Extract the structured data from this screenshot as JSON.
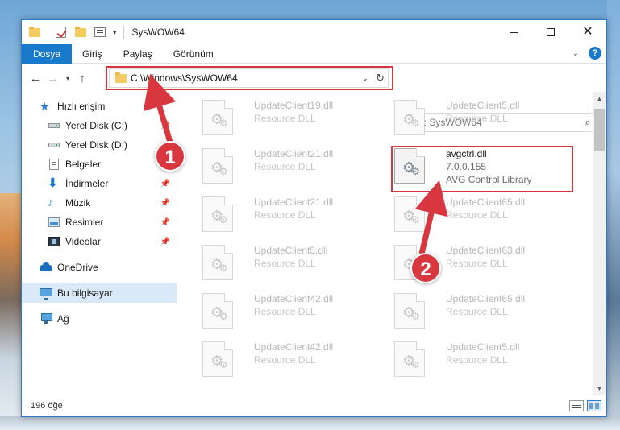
{
  "window": {
    "title": "SysWOW64"
  },
  "ribbon": {
    "tabs": [
      "Dosya",
      "Giriş",
      "Paylaş",
      "Görünüm"
    ],
    "help": "?"
  },
  "nav": {
    "address": "C:\\Windows\\SysWOW64",
    "search_placeholder": "Ara: SysWOW64"
  },
  "sidebar": {
    "items": [
      {
        "label": "Hızlı erişim",
        "icon": "star-icon"
      },
      {
        "label": "Yerel Disk (C:)",
        "icon": "disk-icon"
      },
      {
        "label": "Yerel Disk (D:)",
        "icon": "disk-icon"
      },
      {
        "label": "Belgeler",
        "icon": "document-icon"
      },
      {
        "label": "İndirmeler",
        "icon": "download-icon"
      },
      {
        "label": "Müzik",
        "icon": "music-icon"
      },
      {
        "label": "Resimler",
        "icon": "pictures-icon"
      },
      {
        "label": "Videolar",
        "icon": "video-icon"
      },
      {
        "label": "OneDrive",
        "icon": "onedrive-icon"
      },
      {
        "label": "Bu bilgisayar",
        "icon": "computer-icon"
      },
      {
        "label": "Ağ",
        "icon": "network-icon"
      }
    ]
  },
  "files": {
    "left": [
      {
        "name": "UpdateClient19.dll",
        "desc": "Resource DLL"
      },
      {
        "name": "UpdateClient21.dll",
        "desc": "Resource DLL"
      },
      {
        "name": "UpdateClient21.dll",
        "desc": "Resource DLL"
      },
      {
        "name": "UpdateClient5.dll",
        "desc": "Resource DLL"
      },
      {
        "name": "UpdateClient42.dll",
        "desc": "Resource DLL"
      },
      {
        "name": "UpdateClient42.dll",
        "desc": "Resource DLL"
      }
    ],
    "right": [
      {
        "name": "UpdateClient5.dll",
        "desc": "Resource DLL"
      },
      {
        "name": "UpdateClient65.dll",
        "desc": "Resource DLL"
      },
      {
        "name": "UpdateClient63.dll",
        "desc": "Resource DLL"
      },
      {
        "name": "UpdateClient65.dll",
        "desc": "Resource DLL"
      },
      {
        "name": "UpdateClient5.dll",
        "desc": "Resource DLL"
      }
    ],
    "highlighted": {
      "name": "avgctrl.dll",
      "version": "7.0.0.155",
      "desc": "AVG Control Library"
    }
  },
  "status": {
    "count": "196 öğe"
  },
  "annotations": {
    "marker1": "1",
    "marker2": "2",
    "color": "#d9373f"
  }
}
